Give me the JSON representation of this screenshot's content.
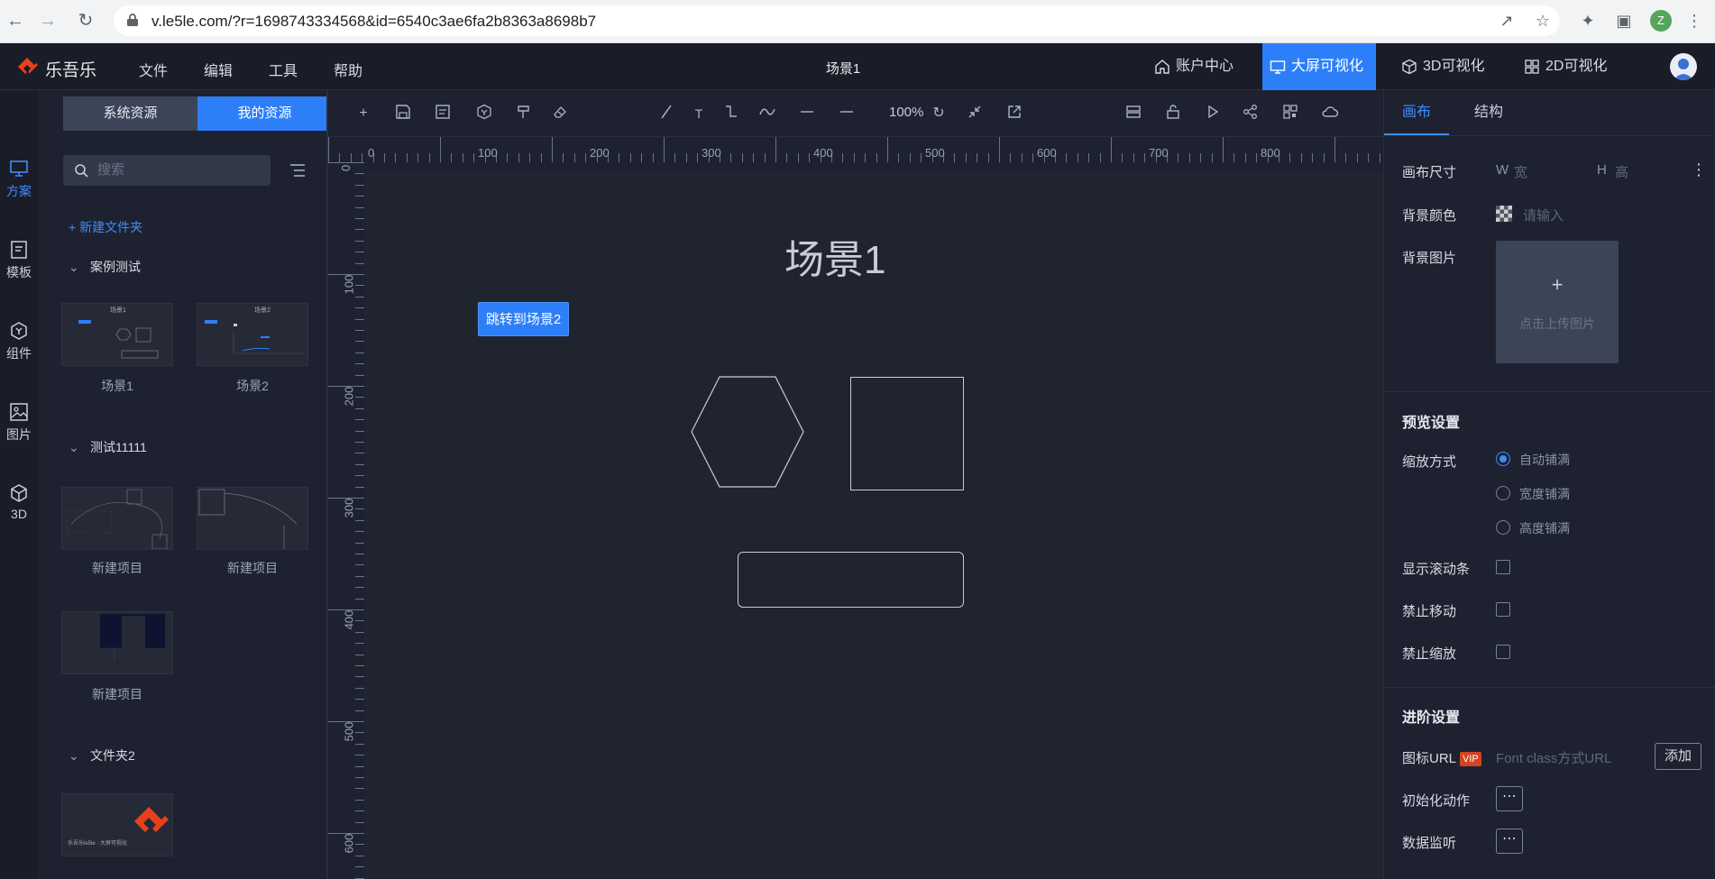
{
  "browser": {
    "url": "v.le5le.com/?r=1698743334568&id=6540c3ae6fa2b8363a8698b7",
    "profile_initial": "Z"
  },
  "header": {
    "logo": "乐吾乐",
    "menu": [
      "文件",
      "编辑",
      "工具",
      "帮助"
    ],
    "scene_title": "场景1",
    "tabs": [
      {
        "label": "账户中心",
        "icon": "home-icon",
        "active": false
      },
      {
        "label": "大屏可视化",
        "icon": "monitor-icon",
        "active": true
      },
      {
        "label": "3D可视化",
        "icon": "cube-icon",
        "active": false
      },
      {
        "label": "2D可视化",
        "icon": "grid-icon",
        "active": false
      }
    ]
  },
  "left_rail": [
    {
      "label": "方案",
      "icon": "monitor-icon",
      "active": true
    },
    {
      "label": "模板",
      "icon": "template-icon",
      "active": false
    },
    {
      "label": "组件",
      "icon": "component-icon",
      "active": false
    },
    {
      "label": "图片",
      "icon": "image-icon",
      "active": false
    },
    {
      "label": "3D",
      "icon": "cube-icon",
      "active": false
    }
  ],
  "resources": {
    "tabs": [
      "系统资源",
      "我的资源"
    ],
    "active_tab": 1,
    "search_placeholder": "搜索",
    "new_folder": "+ 新建文件夹",
    "folders": [
      {
        "name": "案例测试",
        "items": [
          "场景1",
          "场景2"
        ],
        "thumb_titles": [
          "场景1",
          "场景2"
        ]
      },
      {
        "name": "测试11111",
        "items": [
          "新建项目",
          "新建项目",
          "新建项目"
        ]
      },
      {
        "name": "文件夹2",
        "items": [
          ""
        ],
        "thumb_caption": "乐吾乐le5le · 大屏可视化"
      }
    ]
  },
  "toolbar": {
    "zoom": "100%"
  },
  "rulers": {
    "top": [
      "0",
      "100",
      "200",
      "300",
      "400",
      "500",
      "600",
      "700",
      "800"
    ],
    "left": [
      "0",
      "100",
      "200",
      "300",
      "400",
      "500",
      "600"
    ]
  },
  "canvas": {
    "title": "场景1",
    "jump_button": "跳转到场景2"
  },
  "right_panel": {
    "tabs": [
      "画布",
      "结构"
    ],
    "active_tab": 0,
    "canvas_size_label": "画布尺寸",
    "width_prefix": "W",
    "width_placeholder": "宽",
    "height_prefix": "H",
    "height_placeholder": "高",
    "bg_color_label": "背景颜色",
    "bg_color_placeholder": "请输入",
    "bg_image_label": "背景图片",
    "upload_text": "点击上传图片",
    "upload_plus": "+",
    "preview_section": "预览设置",
    "scale_label": "缩放方式",
    "scale_options": [
      "自动铺满",
      "宽度铺满",
      "高度铺满"
    ],
    "scale_selected": 0,
    "show_scrollbar": "显示滚动条",
    "disable_move": "禁止移动",
    "disable_scale": "禁止缩放",
    "advanced_section": "进阶设置",
    "icon_url_label": "图标URL",
    "vip_badge": "VIP",
    "icon_url_placeholder": "Font class方式URL",
    "add_button": "添加",
    "init_action": "初始化动作",
    "data_listen": "数据监听",
    "more": "⋯"
  },
  "colors": {
    "accent": "#2d7ff9",
    "brand": "#e8401c",
    "panel": "#1e2230",
    "canvas": "#20242f"
  }
}
